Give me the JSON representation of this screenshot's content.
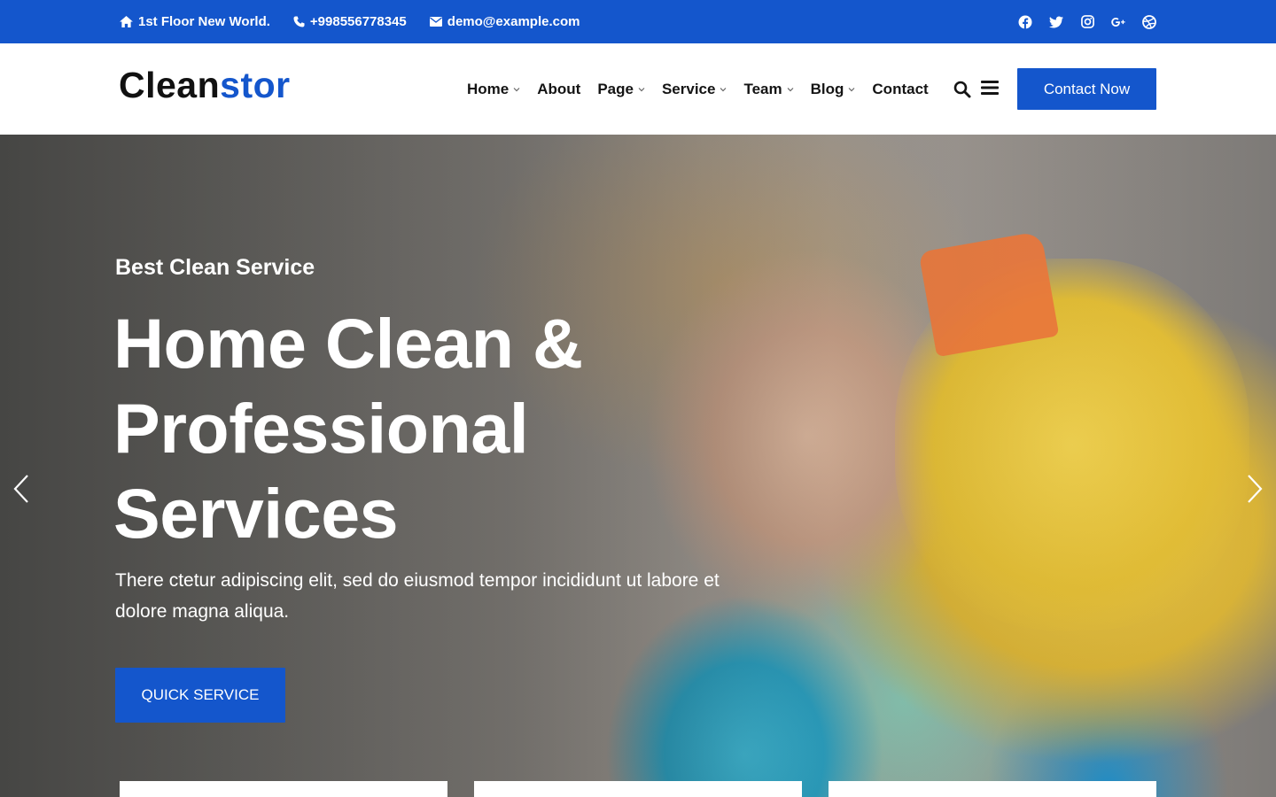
{
  "topbar": {
    "address": "1st Floor New World.",
    "phone": "+998556778345",
    "email": "demo@example.com",
    "icons": [
      "home-icon",
      "phone-icon",
      "envelope-icon"
    ],
    "social": [
      "facebook-icon",
      "twitter-icon",
      "instagram-icon",
      "google-plus-icon",
      "dribbble-icon"
    ]
  },
  "header": {
    "logo_main": "Clean",
    "logo_accent": "stor",
    "nav": [
      {
        "label": "Home",
        "has_dropdown": true
      },
      {
        "label": "About",
        "has_dropdown": false
      },
      {
        "label": "Page",
        "has_dropdown": true
      },
      {
        "label": "Service",
        "has_dropdown": true
      },
      {
        "label": "Team",
        "has_dropdown": true
      },
      {
        "label": "Blog",
        "has_dropdown": true
      },
      {
        "label": "Contact",
        "has_dropdown": false
      }
    ],
    "cta_label": "Contact Now"
  },
  "hero": {
    "eyebrow": "Best Clean Service",
    "headline_line1": "Home Clean &",
    "headline_line2": "Professional",
    "headline_line3": "Services",
    "subtext": "There ctetur adipiscing elit, sed do eiusmod tempor incididunt ut labore et dolore magna aliqua.",
    "button_label": "QUICK SERVICE"
  },
  "colors": {
    "brand": "#1456cc",
    "text_dark": "#141414",
    "white": "#ffffff"
  }
}
